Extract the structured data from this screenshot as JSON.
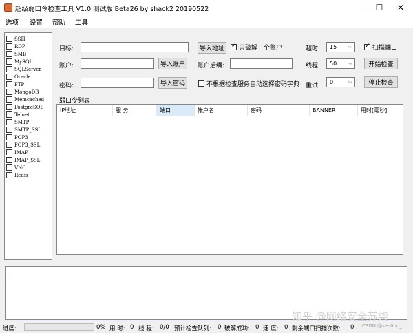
{
  "window": {
    "title": "超级弱口令检查工具 V1.0 测试版 Beta26 by shack2 20190522",
    "minimize": "—",
    "maximize": "☐",
    "close": "✕"
  },
  "menu": [
    "选项",
    "设置",
    "帮助",
    "工具"
  ],
  "protocols": [
    "SSH",
    "RDP",
    "SMB",
    "MySQL",
    "SQLServer",
    "Oracle",
    "FTP",
    "MongoDB",
    "Memcached",
    "PostgreSQL",
    "Telnet",
    "SMTP",
    "SMTP_SSL",
    "POP3",
    "POP3_SSL",
    "IMAP",
    "IMAP_SSL",
    "VNC",
    "Redis"
  ],
  "form": {
    "target_label": "目标:",
    "target_value": "",
    "import_address": "导入地址",
    "crack_one_label": "只破解一个账户",
    "crack_one_checked": true,
    "account_label": "账户:",
    "account_value": "",
    "import_account": "导入账户",
    "account_suffix_label": "账户后缀:",
    "account_suffix_value": "",
    "password_label": "密码:",
    "password_value": "",
    "import_password": "导入密码",
    "no_auto_dict_label": "不根据检查服务自动选择密码字典",
    "no_auto_dict_checked": false,
    "timeout_label": "超时:",
    "timeout_value": "15",
    "threads_label": "线程:",
    "threads_value": "50",
    "retry_label": "重试:",
    "retry_value": "0",
    "scan_port_label": "扫描端口",
    "scan_port_checked": true,
    "start_button": "开始检查",
    "stop_button": "停止检查"
  },
  "table": {
    "title": "弱口令列表",
    "columns": [
      "IP地址",
      "服 务",
      "端口",
      "帐户名",
      "密码",
      "BANNER",
      "用时[毫秒]"
    ],
    "highlighted_column": 2,
    "rows": []
  },
  "log": {
    "value": ""
  },
  "status": {
    "progress_label": "进度:",
    "progress_percent": 0,
    "progress_text": "0%",
    "elapsed_label": "用 时:",
    "elapsed_value": "0",
    "threads_label": "线 程:",
    "threads_value": "0/0",
    "queue_label": "预计检查队列:",
    "queue_value": "0",
    "success_label": "破解成功:",
    "success_value": "0",
    "speed_label": "速 度:",
    "speed_value": "0",
    "remaining_label": "剩余端口扫描次数:",
    "remaining_value": "0"
  },
  "watermark": {
    "text": "知乎 @网络安全苏柒",
    "credit": "CSDN @sec0nd_"
  }
}
